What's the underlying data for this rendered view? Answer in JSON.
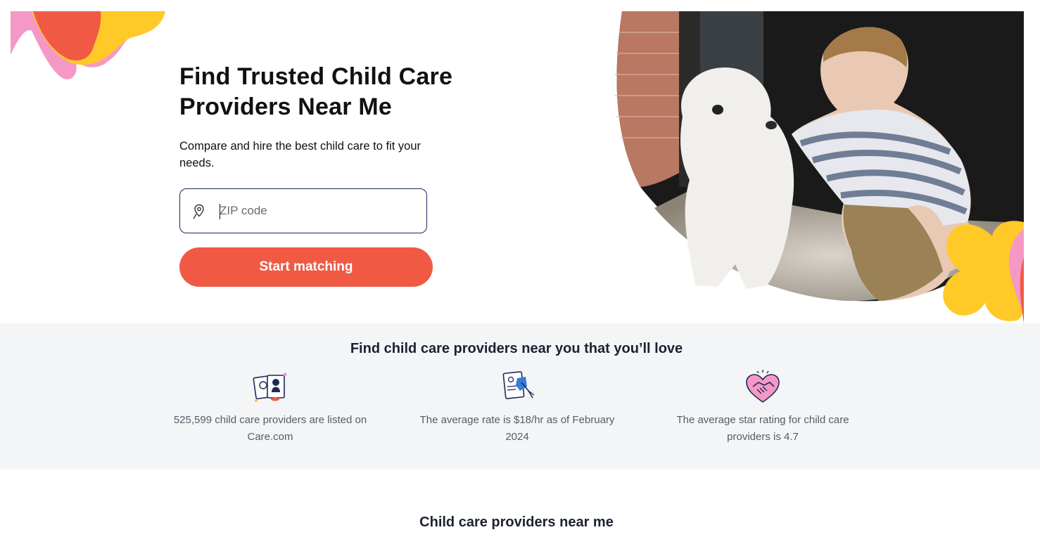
{
  "hero": {
    "title": "Find Trusted Child Care Providers Near Me",
    "subtitle": "Compare and hire the best child care to fit your needs.",
    "zip_placeholder": "ZIP code",
    "zip_value": "",
    "cta_label": "Start matching",
    "icons": {
      "location": "location-pin-icon"
    }
  },
  "stats": {
    "title": "Find child care providers near you that you’ll love",
    "items": [
      {
        "icon": "provider-profiles-icon",
        "text": "525,599 child care providers are listed on Care.com"
      },
      {
        "icon": "rate-document-icon",
        "text": "The average rate is $18/hr as of February 2024"
      },
      {
        "icon": "heart-handshake-icon",
        "text": "The average star rating for child care providers is 4.7"
      }
    ]
  },
  "providers_section": {
    "title": "Child care providers near me"
  },
  "colors": {
    "accent": "#f05a45",
    "input_border": "#1b2a56",
    "stats_bg": "#f4f5f7",
    "blob_yellow": "#ffc928",
    "blob_pink": "#f598c6"
  }
}
